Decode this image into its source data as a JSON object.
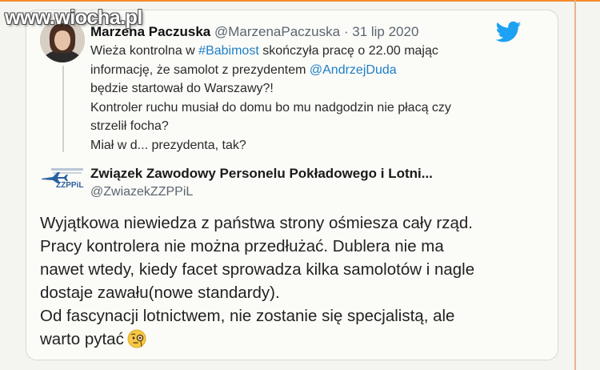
{
  "watermark": {
    "text": "www.wiocha.pl"
  },
  "quoted_tweet": {
    "display_name": "Marzena Paczuska",
    "handle": "@MarzenaPaczuska",
    "separator": "·",
    "date": "31 lip 2020",
    "text": {
      "l1_a": "Wieża kontrolna w ",
      "l1_tag": "#Babimost",
      "l1_b": " skończyła pracę o 22.00 mając",
      "l2_a": "informację, że samolot z prezydentem ",
      "l2_mention": "@AndrzejDuda",
      "l3": "będzie startował do Warszawy?!",
      "l4": "Kontroler ruchu musiał do domu bo mu nadgodzin nie płacą czy",
      "l5": "strzelił focha?",
      "l6": "Miał w d... prezydenta, tak?"
    }
  },
  "reply_tweet": {
    "display_name": "Związek Zawodowy Personelu Pokładowego i Lotni...",
    "handle": "@ZwiazekZZPPiL",
    "logo_text": "ZZPPiL",
    "text": {
      "l1": "Wyjątkowa niewiedza z państwa strony ośmiesza cały rząd.",
      "l2": "Pracy kontrolera nie można przedłużać. Dublera nie ma",
      "l3": "nawet wtedy, kiedy facet sprowadza kilka samolotów i nagle",
      "l4": "dostaje zawału(nowe standardy).",
      "l5": "Od fascynacji lotnictwem, nie zostanie się specjalistą, ale",
      "l6": "warto pytać"
    },
    "emoji": "face-with-monocle-icon"
  },
  "colors": {
    "link": "#1d7fc7",
    "twitter_blue": "#1da1f2",
    "accent_orange": "#f28a2e"
  }
}
